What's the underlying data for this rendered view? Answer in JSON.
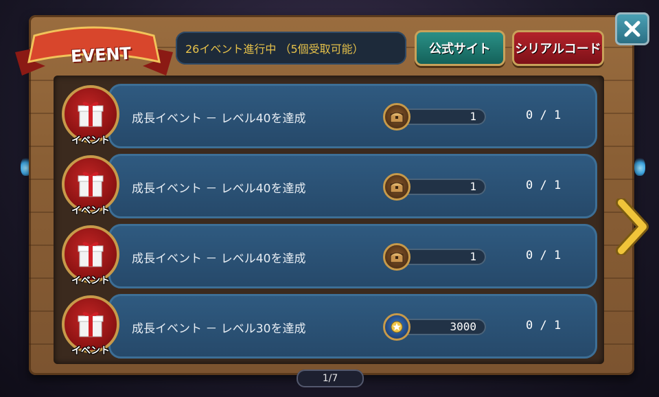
{
  "header": {
    "event_label": "EVENT",
    "status_text": "26イベント進行中 （5個受取可能）",
    "official_site_label": "公式サイト",
    "serial_code_label": "シリアルコード"
  },
  "events": [
    {
      "badge": "イベント",
      "title": "成長イベント － レベル40を達成",
      "reward_icon": "chest-icon",
      "reward_amount": "1",
      "progress": "0 / 1"
    },
    {
      "badge": "イベント",
      "title": "成長イベント － レベル40を達成",
      "reward_icon": "chest-icon",
      "reward_amount": "1",
      "progress": "0 / 1"
    },
    {
      "badge": "イベント",
      "title": "成長イベント － レベル40を達成",
      "reward_icon": "chest-icon",
      "reward_amount": "1",
      "progress": "0 / 1"
    },
    {
      "badge": "イベント",
      "title": "成長イベント － レベル30を達成",
      "reward_icon": "medal-icon",
      "reward_amount": "3000",
      "progress": "0 / 1"
    }
  ],
  "pagination": {
    "label": "1/7"
  },
  "colors": {
    "accent_gold": "#e7c24a",
    "row_blue": "#2f5a80",
    "badge_red": "#c32525"
  }
}
